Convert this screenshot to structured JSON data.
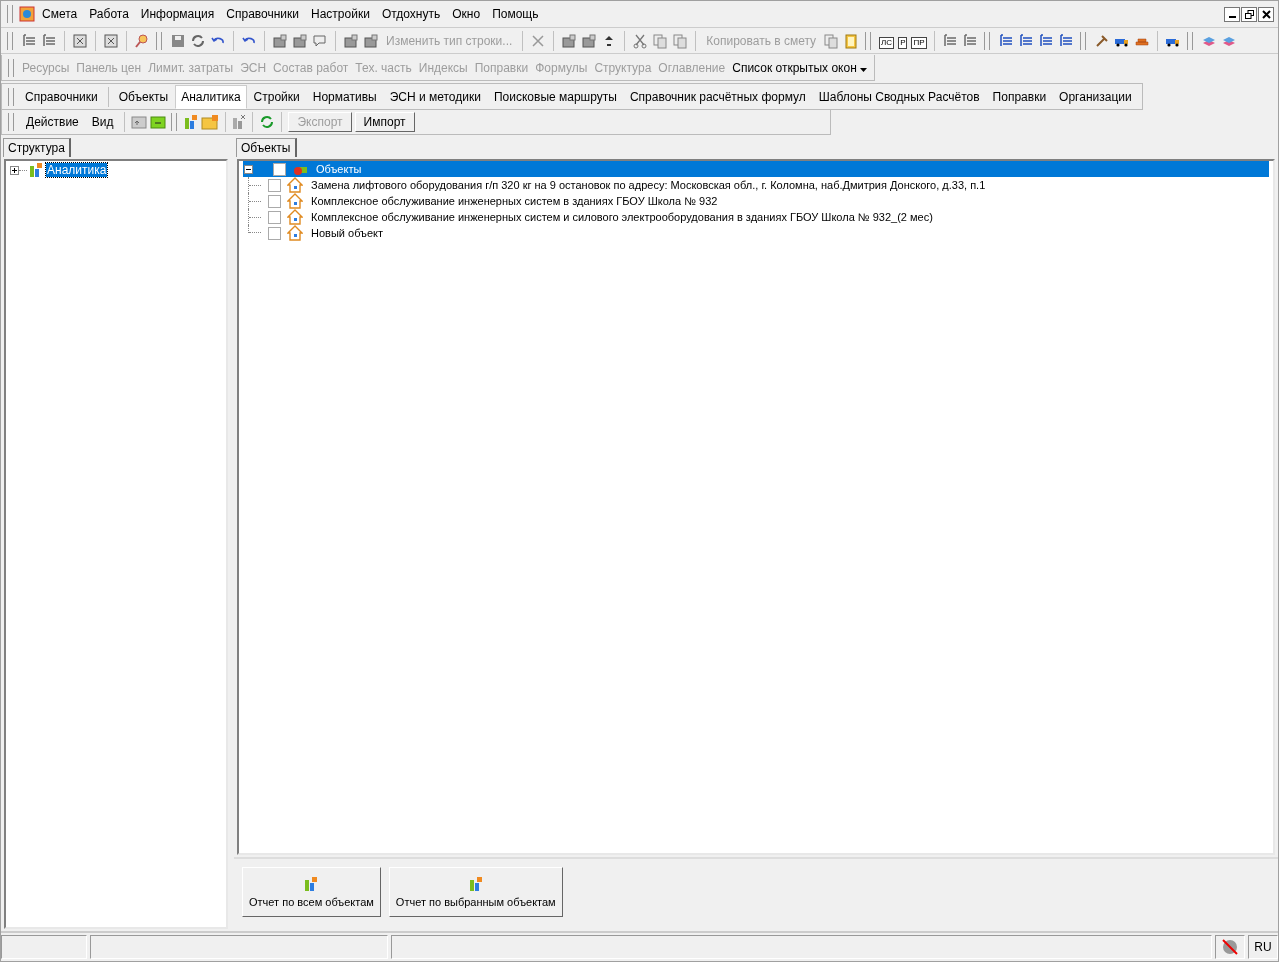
{
  "menu_bar": {
    "items": [
      {
        "label": "Смета"
      },
      {
        "label": "Работа"
      },
      {
        "label": "Информация"
      },
      {
        "label": "Справочники"
      },
      {
        "label": "Настройки"
      },
      {
        "label": "Отдохнуть"
      },
      {
        "label": "Окно"
      },
      {
        "label": "Помощь"
      }
    ]
  },
  "toolbar": {
    "labels": [
      {
        "label": "Изменить тип строки...",
        "disabled": true
      },
      {
        "label": "Копировать в смету",
        "disabled": true
      }
    ],
    "letter_icons": [
      "ЛС",
      "Р",
      "ПР"
    ]
  },
  "nav_bar": {
    "items": [
      {
        "label": "Ресурсы",
        "disabled": true
      },
      {
        "label": "Панель цен",
        "disabled": true
      },
      {
        "label": "Лимит. затраты",
        "disabled": true
      },
      {
        "label": "ЭСН",
        "disabled": true
      },
      {
        "label": "Состав работ",
        "disabled": true
      },
      {
        "label": "Тех. часть",
        "disabled": true
      },
      {
        "label": "Индексы",
        "disabled": true
      },
      {
        "label": "Поправки",
        "disabled": true
      },
      {
        "label": "Формулы",
        "disabled": true
      },
      {
        "label": "Структура",
        "disabled": true
      },
      {
        "label": "Оглавление",
        "disabled": true
      }
    ],
    "dropdown": "Список открытых окон"
  },
  "section_tabs": [
    {
      "label": "Справочники",
      "selected": false
    },
    {
      "label": "Объекты",
      "selected": false
    },
    {
      "label": "Аналитика",
      "selected": true
    },
    {
      "label": "Стройки",
      "selected": false
    },
    {
      "label": "Нормативы",
      "selected": false
    },
    {
      "label": "ЭСН и методики",
      "selected": false
    },
    {
      "label": "Поисковые маршруты",
      "selected": false
    },
    {
      "label": "Справочник расчётных формул",
      "selected": false
    },
    {
      "label": "Шаблоны Сводных Расчётов",
      "selected": false
    },
    {
      "label": "Поправки",
      "selected": false
    },
    {
      "label": "Организации",
      "selected": false
    }
  ],
  "action_bar": {
    "menus": [
      "Действие",
      "Вид"
    ],
    "buttons": [
      {
        "label": "Экспорт",
        "disabled": true
      },
      {
        "label": "Импорт",
        "disabled": false
      }
    ]
  },
  "left_panel": {
    "tab": "Структура",
    "tree": [
      {
        "label": "Аналитика",
        "expanded": false,
        "selected": true
      }
    ]
  },
  "main_panel": {
    "tab": "Объекты",
    "tree": {
      "label": "Объекты",
      "expanded": true,
      "selected": true,
      "checked": false,
      "children": [
        {
          "label": "Замена лифтового оборудования г/п 320 кг на 9 остановок по адресу: Московская обл., г. Коломна, наб.Дмитрия Донского, д.33, п.1",
          "checked": false,
          "selected": false
        },
        {
          "label": "Комплексное обслуживание инженерных систем в зданиях ГБОУ Школа № 932",
          "checked": false,
          "selected": false
        },
        {
          "label": "Комплексное обслуживание инженерных систем и силового электрооборудования в зданиях ГБОУ Школа № 932_(2 мес)",
          "checked": false,
          "selected": false
        },
        {
          "label": "Новый объект",
          "checked": false,
          "selected": false
        }
      ]
    }
  },
  "report_buttons": [
    "Отчет по всем объектам",
    "Отчет по выбранным объектам"
  ],
  "status_bar": {
    "language": "RU"
  }
}
